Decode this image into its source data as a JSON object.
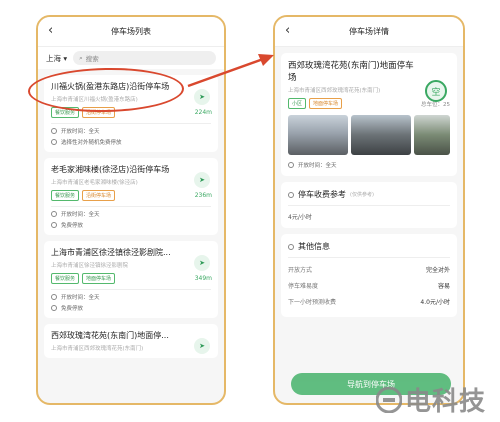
{
  "left": {
    "title": "停车场列表",
    "city": "上海",
    "search_placeholder": "搜索",
    "cards": [
      {
        "title": "川福火锅(盈港东路店)沿街停车场",
        "address": "上海市青浦区川福火锅(盈港东路店)",
        "tags": [
          "餐饮服务",
          "沿街停车场"
        ],
        "distance": "224m",
        "info": [
          "开放时间：全天",
          "选择性对外随机免费停放"
        ]
      },
      {
        "title": "老毛家湘味楼(徐泾店)沿街停车场",
        "address": "上海市青浦区老毛家湘味楼(徐泾店)",
        "tags": [
          "餐饮服务",
          "沿街停车场"
        ],
        "distance": "236m",
        "info": [
          "开放时间：全天",
          "免费停放"
        ]
      },
      {
        "title": "上海市青浦区徐泾镇徐泾影剧院...",
        "address": "上海市青浦区徐泾镇徐泾影剧院",
        "tags": [
          "餐饮服务",
          "地面停车场"
        ],
        "distance": "349m",
        "info": [
          "开放时间：全天",
          "免费停放"
        ]
      },
      {
        "title": "西郊玫瑰湾花苑(东南门)地面停...",
        "address": "上海市青浦区西郊玫瑰湾花苑(东南门)",
        "tags": [],
        "distance": "",
        "info": []
      }
    ]
  },
  "right": {
    "title": "停车场详情",
    "name": "西郊玫瑰湾花苑(东南门)地面停车场",
    "address": "上海市青浦区西郊玫瑰湾花苑(东南门)",
    "status": "空",
    "tags": [
      "小区",
      "地面停车场"
    ],
    "total_label": "总车位",
    "total_value": "25",
    "open_time": "开放时间：全天",
    "fee_title": "停车收费参考",
    "fee_note": "(仅供参考)",
    "fee_value": "4元/小时",
    "other_title": "其他信息",
    "other": [
      {
        "k": "开放方式",
        "v": "完全对外"
      },
      {
        "k": "停车难易度",
        "v": "容易"
      },
      {
        "k": "下一小时预测收费",
        "v": "4.0元/小时"
      }
    ],
    "nav_button": "导航到停车场"
  },
  "watermark": {
    "text": "电科技",
    "mark": "®"
  },
  "colors": {
    "accent": "#46b36b",
    "frame": "#e5b867",
    "annotation": "#d9482e"
  }
}
